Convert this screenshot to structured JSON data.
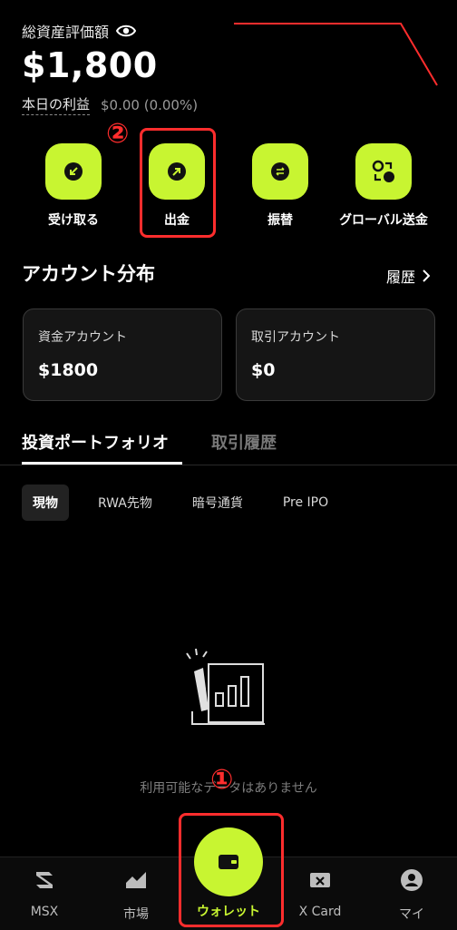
{
  "header": {
    "total_assets_label": "総資産評価額",
    "balance": "$1,800",
    "profit_label": "本日の利益",
    "profit_value": "$0.00 (0.00%)"
  },
  "actions": [
    {
      "label": "受け取る",
      "icon": "receive-icon"
    },
    {
      "label": "出金",
      "icon": "withdraw-icon"
    },
    {
      "label": "振替",
      "icon": "transfer-icon"
    },
    {
      "label": "グローバル送金",
      "icon": "global-send-icon"
    }
  ],
  "annotations": {
    "step1": "①",
    "step2": "②"
  },
  "account_section": {
    "title": "アカウント分布",
    "history_link": "履歴"
  },
  "cards": [
    {
      "label": "資金アカウント",
      "value": "$1800"
    },
    {
      "label": "取引アカウント",
      "value": "$0"
    }
  ],
  "tabs": [
    {
      "label": "投資ポートフォリオ",
      "active": true
    },
    {
      "label": "取引履歴",
      "active": false
    }
  ],
  "subtabs": [
    {
      "label": "現物",
      "active": true
    },
    {
      "label": "RWA先物",
      "active": false
    },
    {
      "label": "暗号通貨",
      "active": false
    },
    {
      "label": "Pre IPO",
      "active": false
    }
  ],
  "empty_state": {
    "text": "利用可能なデータはありません"
  },
  "bottom_nav": [
    {
      "label": "MSX",
      "icon": "msx-logo-icon"
    },
    {
      "label": "市場",
      "icon": "market-chart-icon"
    },
    {
      "label": "ウォレット",
      "icon": "wallet-icon",
      "active": true
    },
    {
      "label": "X Card",
      "icon": "xcard-icon"
    },
    {
      "label": "マイ",
      "icon": "profile-icon"
    }
  ],
  "colors": {
    "accent": "#c8f531",
    "highlight": "#ff2d2d",
    "background": "#000000"
  }
}
